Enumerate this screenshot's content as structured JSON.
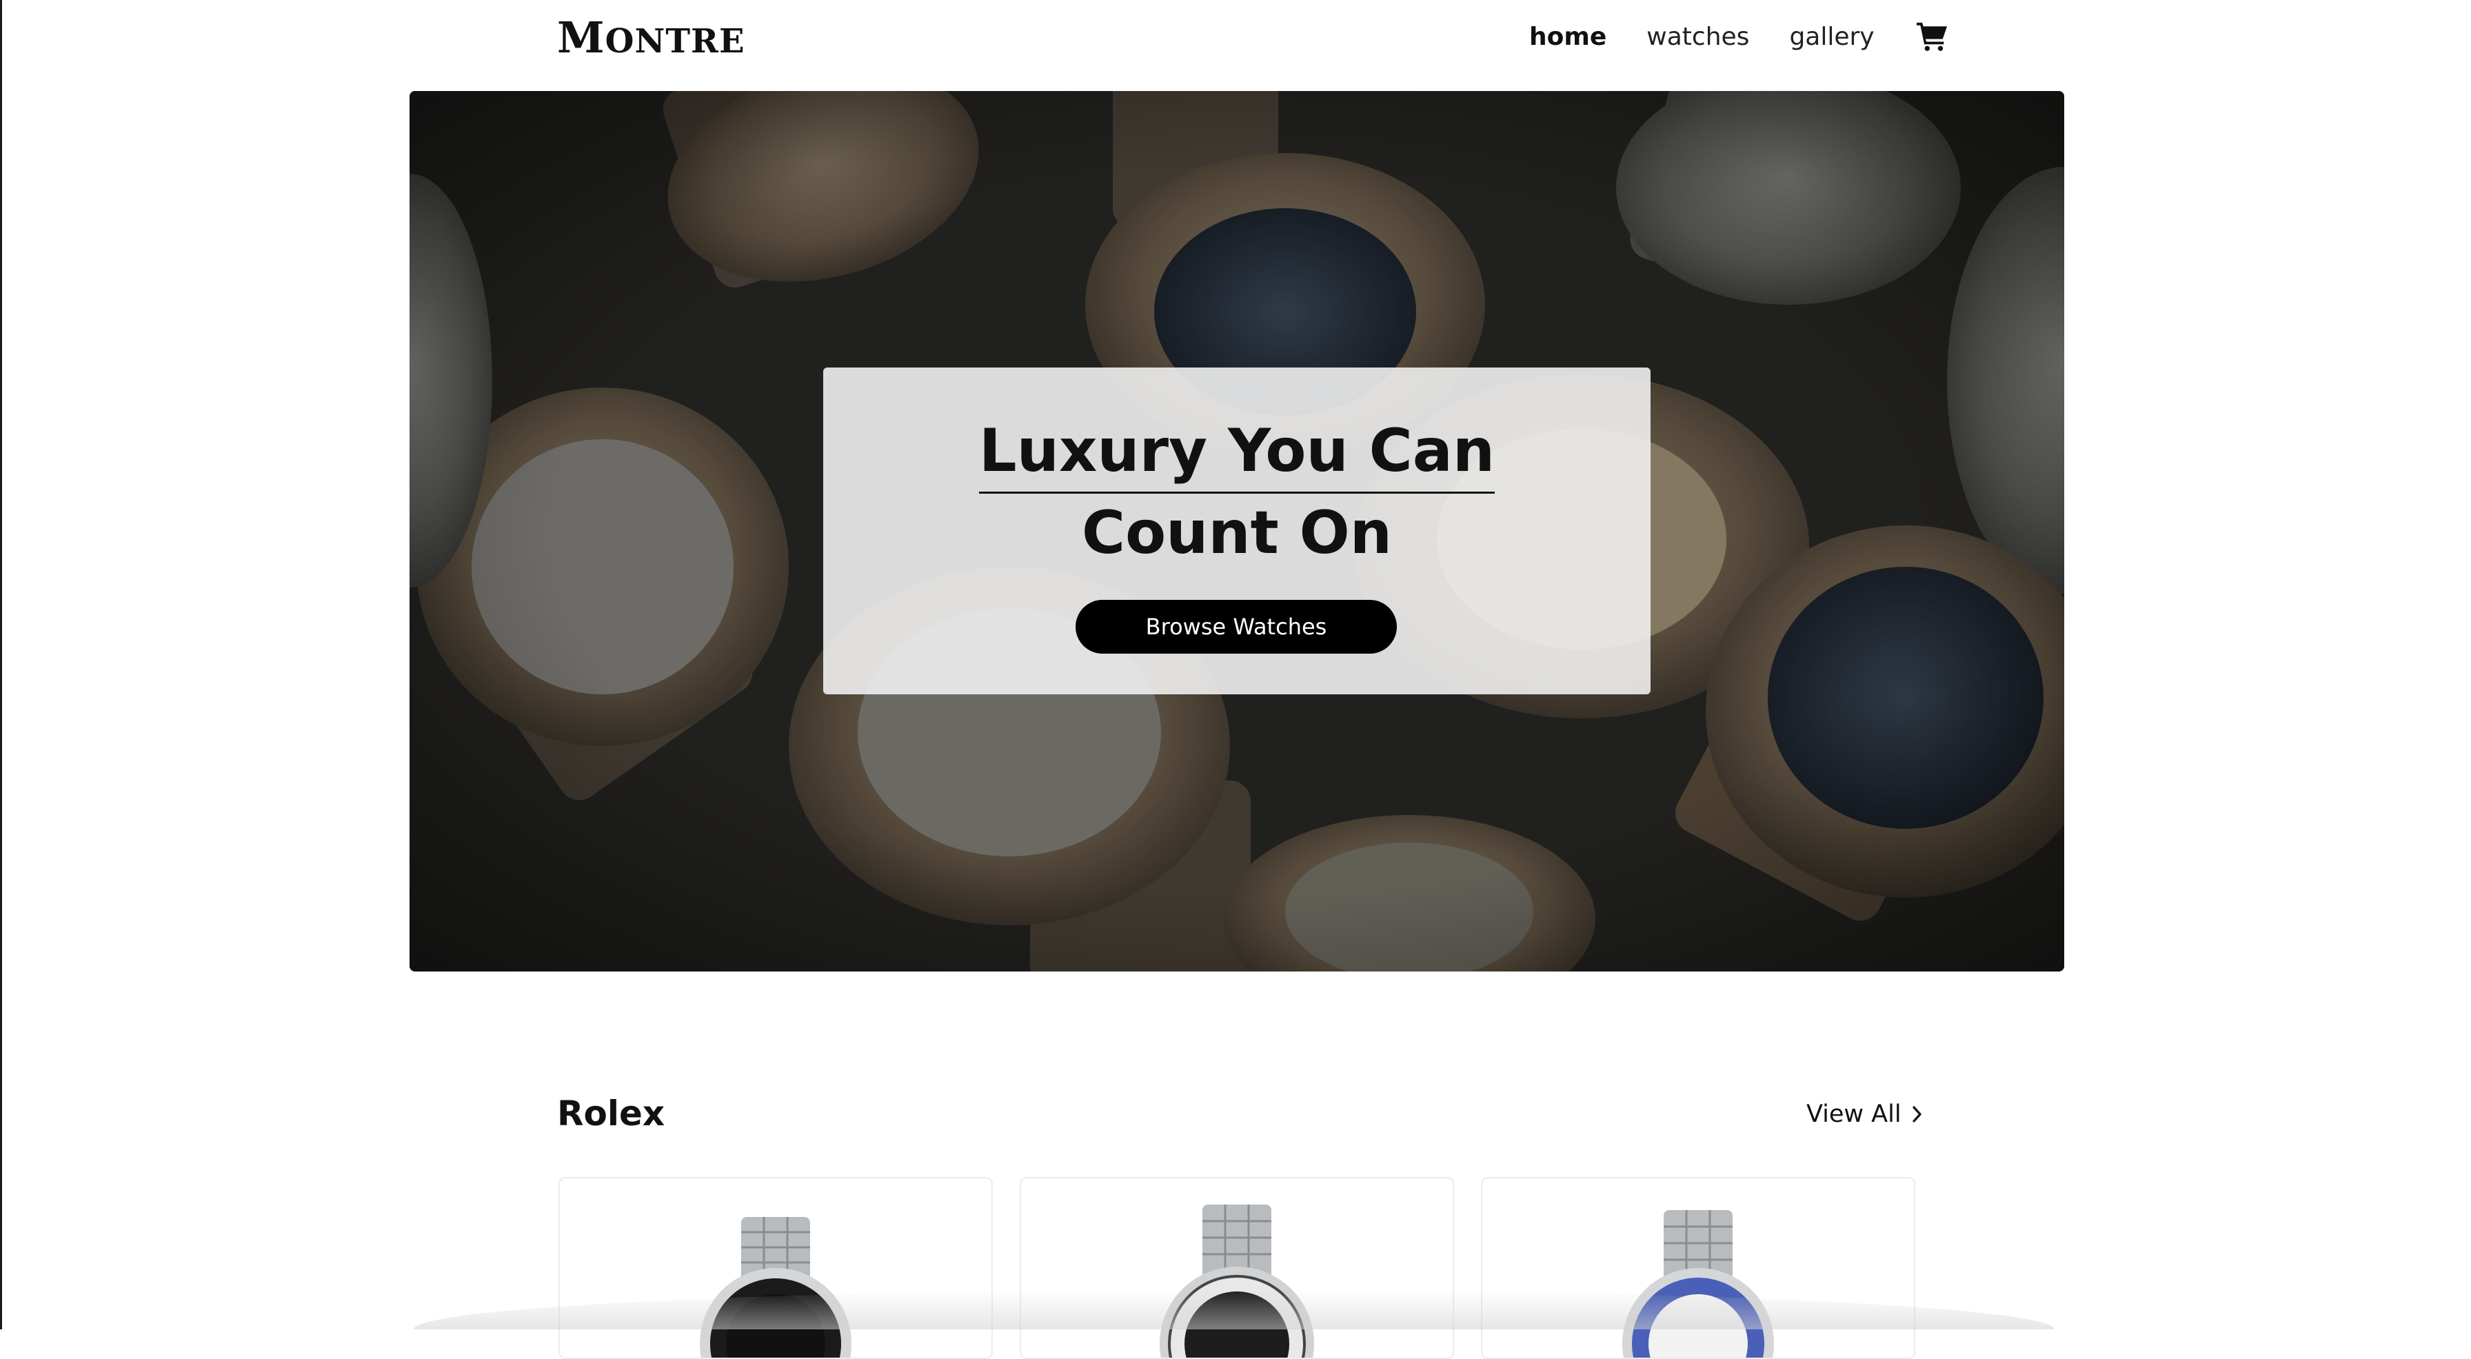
{
  "brand": {
    "logo_first": "M",
    "logo_rest": "ONTRE"
  },
  "nav": {
    "links": [
      {
        "label": "home",
        "active": true
      },
      {
        "label": "watches",
        "active": false
      },
      {
        "label": "gallery",
        "active": false
      }
    ],
    "cart_icon": "cart-icon"
  },
  "hero": {
    "title_line1": "Luxury You Can",
    "title_line2": "Count On",
    "cta_label": "Browse Watches"
  },
  "section": {
    "title": "Rolex",
    "view_all_label": "View All",
    "view_all_icon": "chevron-right-icon"
  },
  "products": [
    {
      "image": "watch-black-bezel",
      "bezel_color": "#1b1b1b"
    },
    {
      "image": "watch-black-dial",
      "bezel_color": "#cfcfcf"
    },
    {
      "image": "watch-blue-bezel",
      "bezel_color": "#4a60b8"
    }
  ],
  "colors": {
    "accent": "#000000",
    "background": "#ffffff",
    "text": "#111111"
  }
}
